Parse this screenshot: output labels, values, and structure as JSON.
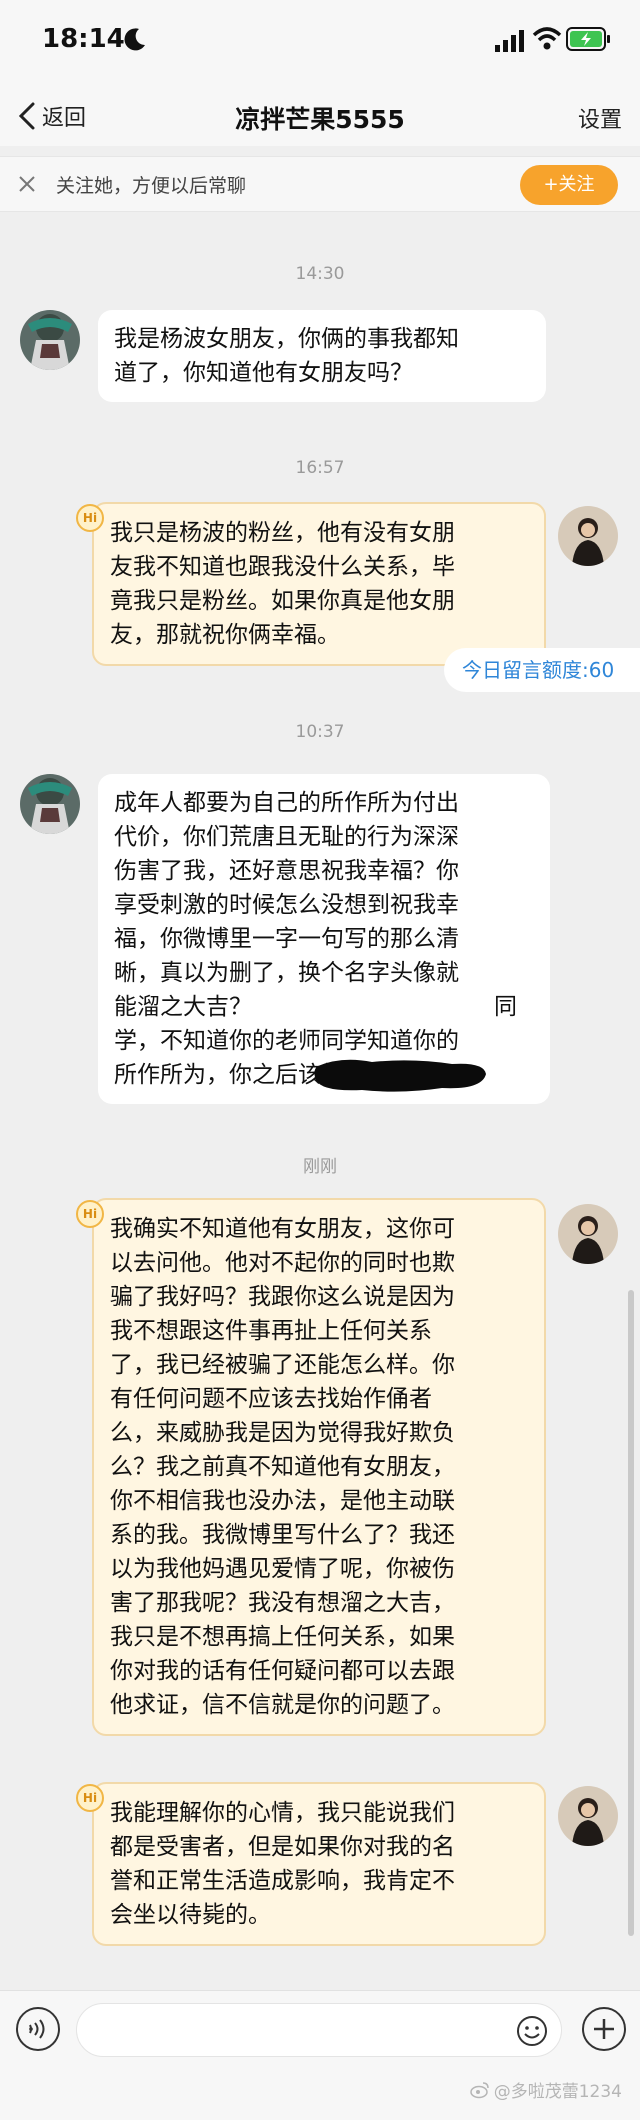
{
  "status_bar": {
    "time": "18:14"
  },
  "nav": {
    "back_label": "返回",
    "title": "凉拌芒果5555",
    "settings_label": "设置"
  },
  "follow_bar": {
    "hint": "关注她，方便以后常聊",
    "button_label": "+关注"
  },
  "messages": [
    {
      "timestamp": "14:30",
      "direction": "incoming",
      "lines": [
        "我是杨波女朋友，你俩的事我都知",
        "道了，你知道他有女朋友吗？"
      ]
    },
    {
      "timestamp": "16:57",
      "direction": "outgoing",
      "badge": "Hi",
      "lines": [
        "我只是杨波的粉丝，他有没有女朋",
        "友我不知道也跟我没什么关系，毕",
        "竟我只是粉丝。如果你真是他女朋",
        "友，那就祝你俩幸福。"
      ]
    },
    {
      "timestamp": "10:37",
      "direction": "incoming",
      "lines": [
        "成年人都要为自己的所作所为付出",
        "代价，你们荒唐且无耻的行为深深",
        "伤害了我，还好意思祝我幸福？你",
        "享受刺激的时候怎么没想到祝我幸",
        "福，你微博里一字一句写的那么清",
        "晰，真以为删了，换个名字头像就",
        "能溜之大吉？",
        "学，不知道你的老师同学知道你的",
        "所作所为，你之后该如何自处啊？"
      ],
      "line7_tail": "同"
    },
    {
      "timestamp": "刚刚",
      "direction": "outgoing",
      "badge": "Hi",
      "lines": [
        "我确实不知道他有女朋友，这你可",
        "以去问他。他对不起你的同时也欺",
        "骗了我好吗？我跟你这么说是因为",
        "我不想跟这件事再扯上任何关系",
        "了，我已经被骗了还能怎么样。你",
        "有任何问题不应该去找始作俑者",
        "么，来威胁我是因为觉得我好欺负",
        "么？我之前真不知道他有女朋友，",
        "你不相信我也没办法，是他主动联",
        "系的我。我微博里写什么了？我还",
        "以为我他妈遇见爱情了呢，你被伤",
        "害了那我呢？我没有想溜之大吉，",
        "我只是不想再搞上任何关系，如果",
        "你对我的话有任何疑问都可以去跟",
        "他求证，信不信就是你的问题了。"
      ]
    },
    {
      "direction": "outgoing",
      "badge": "Hi",
      "lines": [
        "我能理解你的心情，我只能说我们",
        "都是受害者，但是如果你对我的名",
        "誉和正常生活造成影响，我肯定不",
        "会坐以待毙的。"
      ]
    }
  ],
  "quota": "今日留言额度:60",
  "watermark": "@多啦茂蕾1234",
  "colors": {
    "follow_button": "#f7a32c",
    "outgoing_bubble": "#fff6e1",
    "quota_text": "#2f86d8"
  }
}
